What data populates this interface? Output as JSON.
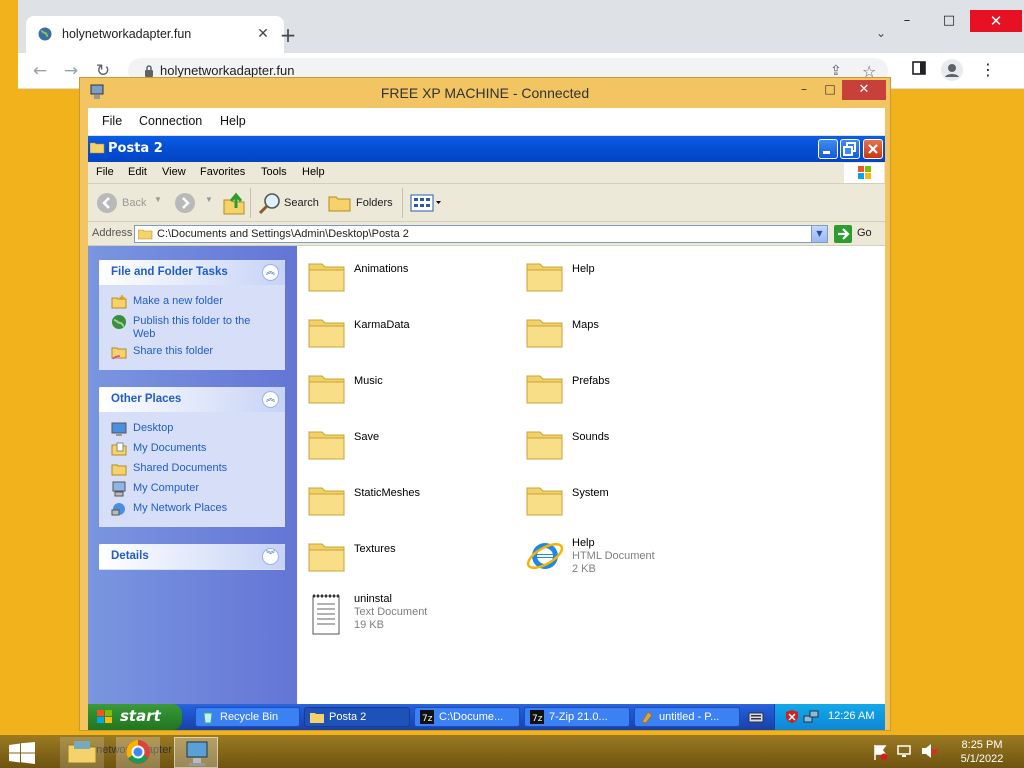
{
  "browser": {
    "tab_title": "holynetworkadapter.fun",
    "url": "holynetworkadapter.fun",
    "new_tab": "+",
    "close_tab": "✕",
    "tab_search": "⌄",
    "window_minimize": "–",
    "window_maximize": "□",
    "window_close": "✕"
  },
  "rdp": {
    "title": "FREE XP MACHINE - Connected",
    "menu": [
      "File",
      "Connection",
      "Help"
    ],
    "min": "–",
    "max": "□",
    "close": "✕"
  },
  "explorer": {
    "title": "Posta 2",
    "menu": [
      "File",
      "Edit",
      "View",
      "Favorites",
      "Tools",
      "Help"
    ],
    "toolbar": {
      "back": "Back",
      "search": "Search",
      "folders": "Folders"
    },
    "address_label": "Address",
    "address_value": "C:\\Documents and Settings\\Admin\\Desktop\\Posta 2",
    "go": "Go",
    "tasks_panel": {
      "title": "File and Folder Tasks",
      "items": [
        "Make a new folder",
        "Publish this folder to the Web",
        "Share this folder"
      ]
    },
    "places_panel": {
      "title": "Other Places",
      "items": [
        "Desktop",
        "My Documents",
        "Shared Documents",
        "My Computer",
        "My Network Places"
      ]
    },
    "details_panel": {
      "title": "Details"
    },
    "files": [
      {
        "name": "Animations",
        "type": "folder"
      },
      {
        "name": "Help",
        "type": "folder"
      },
      {
        "name": "KarmaData",
        "type": "folder"
      },
      {
        "name": "Maps",
        "type": "folder"
      },
      {
        "name": "Music",
        "type": "folder"
      },
      {
        "name": "Prefabs",
        "type": "folder"
      },
      {
        "name": "Save",
        "type": "folder"
      },
      {
        "name": "Sounds",
        "type": "folder"
      },
      {
        "name": "StaticMeshes",
        "type": "folder"
      },
      {
        "name": "System",
        "type": "folder"
      },
      {
        "name": "Textures",
        "type": "folder"
      },
      {
        "name": "Help",
        "type": "html",
        "kind": "HTML Document",
        "size": "2 KB"
      },
      {
        "name": "uninstal",
        "type": "text",
        "kind": "Text Document",
        "size": "19 KB"
      }
    ]
  },
  "xp_taskbar": {
    "start": "start",
    "buttons": [
      "Recycle Bin",
      "Posta 2",
      "C:\\Docume...",
      "7-Zip 21.0...",
      "untitled - P..."
    ],
    "clock": "12:26 AM"
  },
  "win8_taskbar": {
    "behind_text": "holynetworkadapter",
    "time": "8:25 PM",
    "date": "5/1/2022"
  },
  "colors": {
    "desktop": "#f2b21b",
    "xp_blue": "#0550d6",
    "xp_link": "#215dc6"
  }
}
